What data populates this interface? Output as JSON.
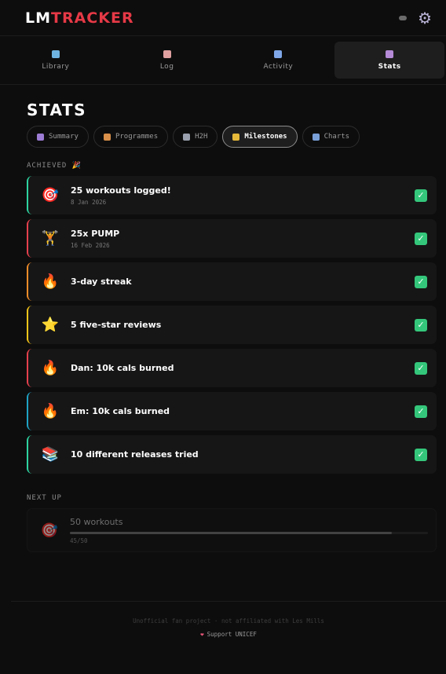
{
  "header": {
    "logo_lm": "LM",
    "logo_tracker": "TRACKER"
  },
  "nav": [
    {
      "label": "Library",
      "icon": "books-icon",
      "color": "#6fb3e0"
    },
    {
      "label": "Log",
      "icon": "memo-icon",
      "color": "#e0a0a0"
    },
    {
      "label": "Activity",
      "icon": "calendar-icon",
      "color": "#7fa7e8"
    },
    {
      "label": "Stats",
      "icon": "bar-chart-icon",
      "color": "#b58bd8",
      "active": true
    }
  ],
  "page_title": "STATS",
  "subtabs": [
    {
      "label": "Summary",
      "icon": "bar-chart-icon",
      "color": "#9c7cd4"
    },
    {
      "label": "Programmes",
      "icon": "weightlifter-icon",
      "color": "#d9904a"
    },
    {
      "label": "H2H",
      "icon": "crossed-swords-icon",
      "color": "#9aa0ad"
    },
    {
      "label": "Milestones",
      "icon": "trophy-icon",
      "color": "#e7b93a",
      "active": true
    },
    {
      "label": "Charts",
      "icon": "chart-up-icon",
      "color": "#7aa0d8"
    }
  ],
  "achieved_label": "ACHIEVED 🎉",
  "milestones": [
    {
      "title": "25 workouts logged!",
      "date": "8 Jan 2026",
      "emoji": "🎯",
      "border": "#2dd4a0"
    },
    {
      "title": "25x PUMP",
      "date": "16 Feb 2026",
      "emoji": "🏋",
      "border": "#e6404d"
    },
    {
      "title": "3-day streak",
      "date": "",
      "emoji": "🔥",
      "border": "#f28c28"
    },
    {
      "title": "5 five-star reviews",
      "date": "",
      "emoji": "⭐",
      "border": "#f5c518"
    },
    {
      "title": "Dan: 10k cals burned",
      "date": "",
      "emoji": "🔥",
      "border": "#e6404d"
    },
    {
      "title": "Em: 10k cals burned",
      "date": "",
      "emoji": "🔥",
      "border": "#1fa3c6"
    },
    {
      "title": "10 different releases tried",
      "date": "",
      "emoji": "📚",
      "border": "#2dd4a0"
    }
  ],
  "next_up_label": "NEXT UP",
  "next_up": {
    "title": "50 workouts",
    "count": "45/50",
    "progress": 0.9,
    "emoji": "🎯"
  },
  "footer": {
    "note": "Unofficial fan project · not affiliated with Les Mills",
    "support": "Support UNICEF"
  }
}
